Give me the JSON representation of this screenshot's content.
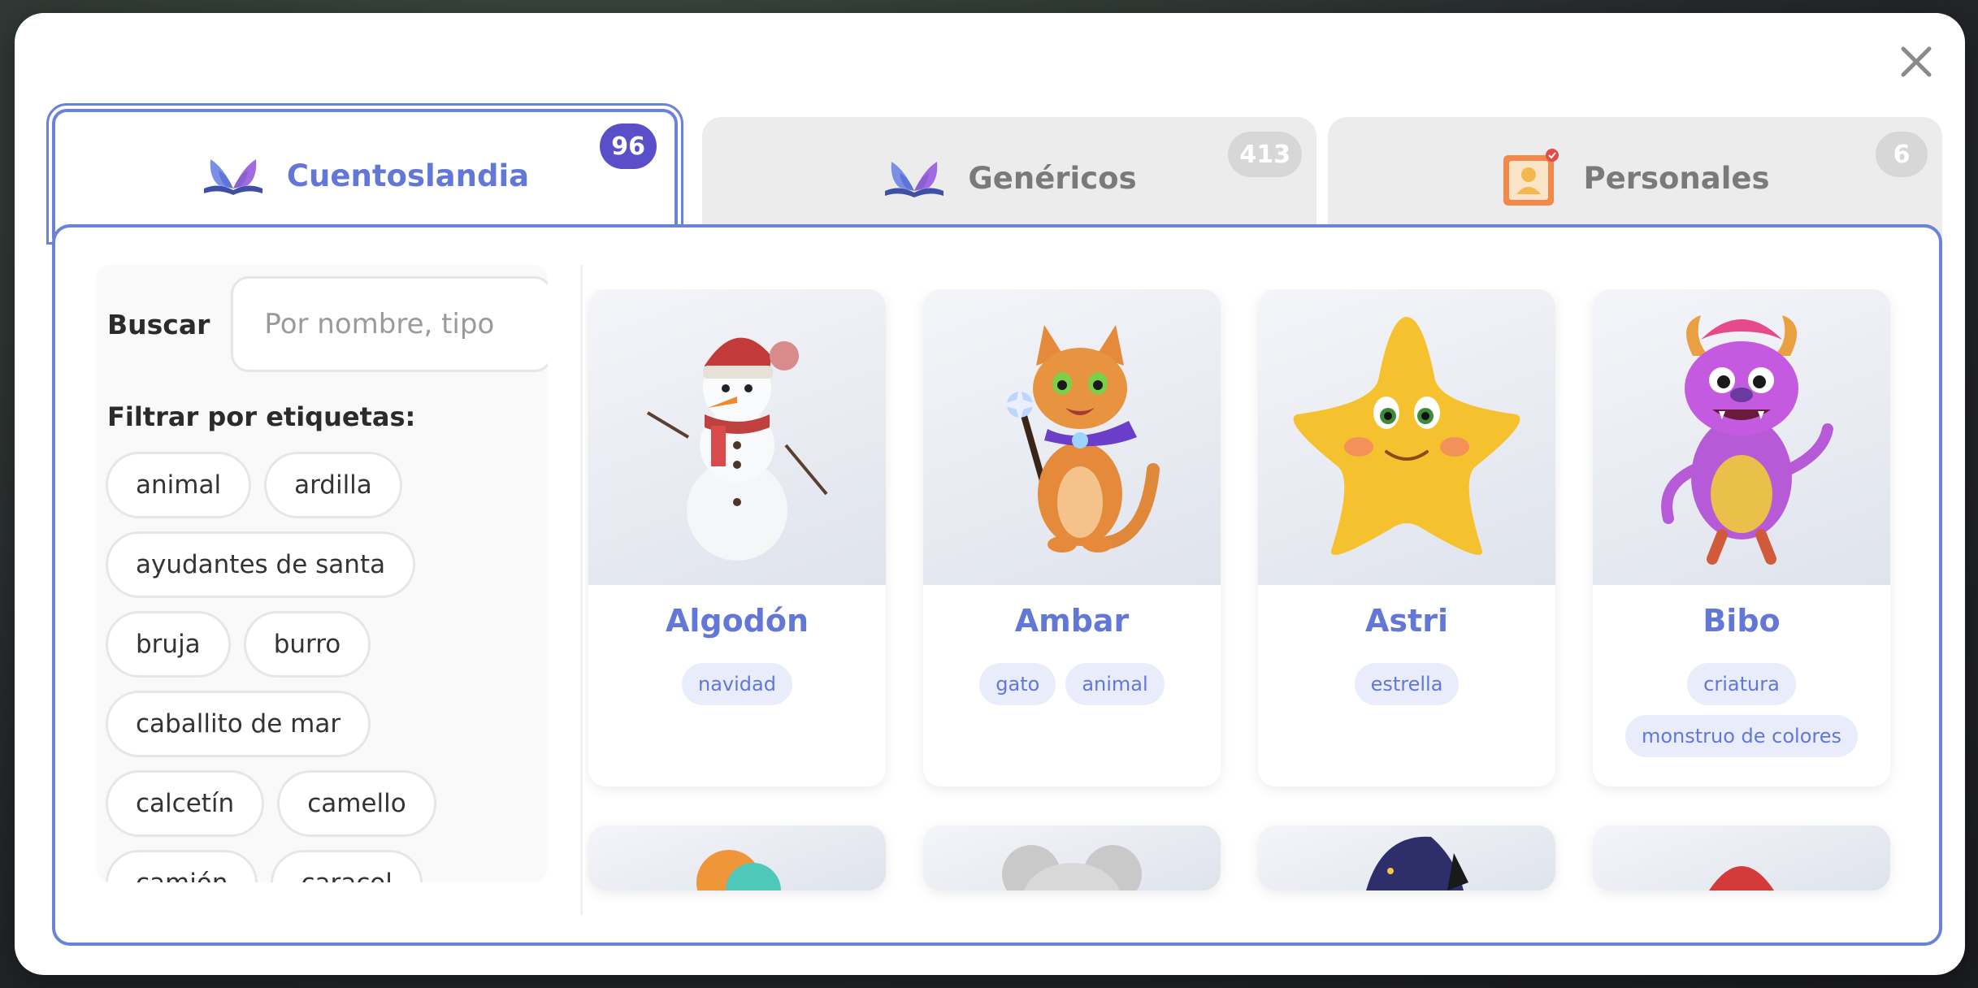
{
  "tabs": [
    {
      "label": "Cuentoslandia",
      "count": "96",
      "icon": "book-butterfly-icon"
    },
    {
      "label": "Genéricos",
      "count": "413",
      "icon": "book-butterfly-icon"
    },
    {
      "label": "Personales",
      "count": "6",
      "icon": "personal-portrait-icon"
    }
  ],
  "active_tab": "Cuentoslandia",
  "search": {
    "label": "Buscar",
    "placeholder": "Por nombre, tipo",
    "value": ""
  },
  "filters": {
    "title": "Filtrar por etiquetas:",
    "tags": [
      "animal",
      "ardilla",
      "ayudantes de santa",
      "bruja",
      "burro",
      "caballito de mar",
      "calcetín",
      "camello",
      "camión",
      "caracol"
    ]
  },
  "characters": [
    {
      "name": "Algodón",
      "tags": [
        "navidad"
      ],
      "image": "snowman"
    },
    {
      "name": "Ambar",
      "tags": [
        "gato",
        "animal"
      ],
      "image": "cat-wizard"
    },
    {
      "name": "Astri",
      "tags": [
        "estrella"
      ],
      "image": "star"
    },
    {
      "name": "Bibo",
      "tags": [
        "criatura",
        "monstruo de colores"
      ],
      "image": "monster"
    }
  ],
  "colors": {
    "accent": "#6277d6",
    "border": "#6b82db",
    "badge_active": "#5a4fc9",
    "tag_bg": "#e9edfb"
  }
}
